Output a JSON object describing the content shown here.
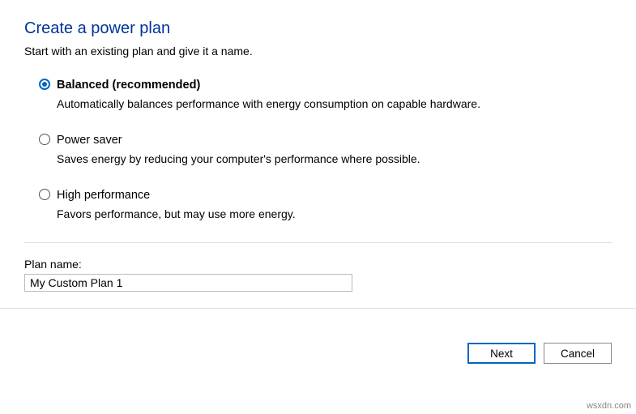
{
  "title": "Create a power plan",
  "subtitle": "Start with an existing plan and give it a name.",
  "options": [
    {
      "label": "Balanced (recommended)",
      "desc": "Automatically balances performance with energy consumption on capable hardware.",
      "selected": true
    },
    {
      "label": "Power saver",
      "desc": "Saves energy by reducing your computer's performance where possible.",
      "selected": false
    },
    {
      "label": "High performance",
      "desc": "Favors performance, but may use more energy.",
      "selected": false
    }
  ],
  "plan_name_label": "Plan name:",
  "plan_name_value": "My Custom Plan 1",
  "buttons": {
    "next": "Next",
    "cancel": "Cancel"
  },
  "watermark": "wsxdn.com"
}
